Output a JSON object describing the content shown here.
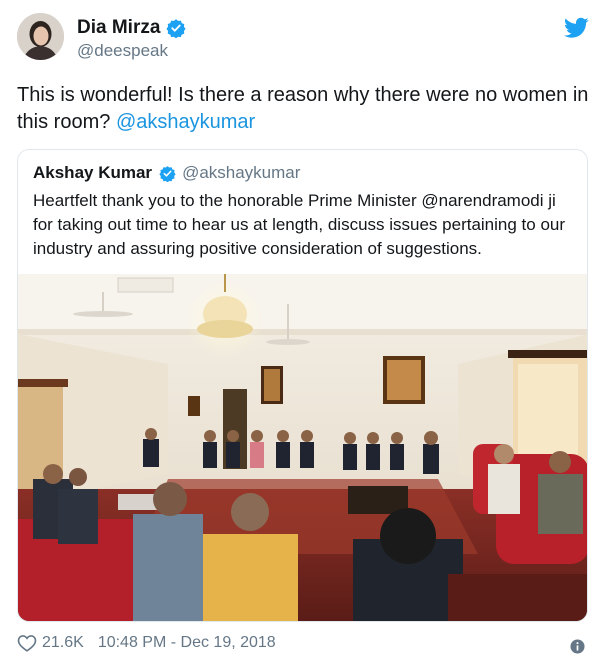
{
  "author": {
    "name": "Dia Mirza",
    "handle": "@deespeak",
    "avatar_icon": "avatar-icon",
    "verified_icon": "verified-badge-icon"
  },
  "brand_icon": "twitter-bird-icon",
  "tweet": {
    "text": "This is wonderful! Is there a reason why there were no women in this room?",
    "mention": "@akshaykumar"
  },
  "quoted_tweet": {
    "name": "Akshay Kumar",
    "handle": "@akshaykumar",
    "text_before": "Heartfelt thank you to the honorable Prime Minister",
    "mention": "@narendramodi",
    "text_after": "ji for taking out time to hear us at length, discuss issues pertaining to our industry and assuring positive consideration of suggestions."
  },
  "footer": {
    "like_icon": "heart-icon",
    "likes": "21.6K",
    "timestamp": "10:48 PM - Dec 19, 2018",
    "info_icon": "info-icon"
  },
  "colors": {
    "link": "#1b95e0",
    "secondary_text": "#657786",
    "border": "#e1e8ed",
    "twitter_blue": "#1da1f2"
  }
}
